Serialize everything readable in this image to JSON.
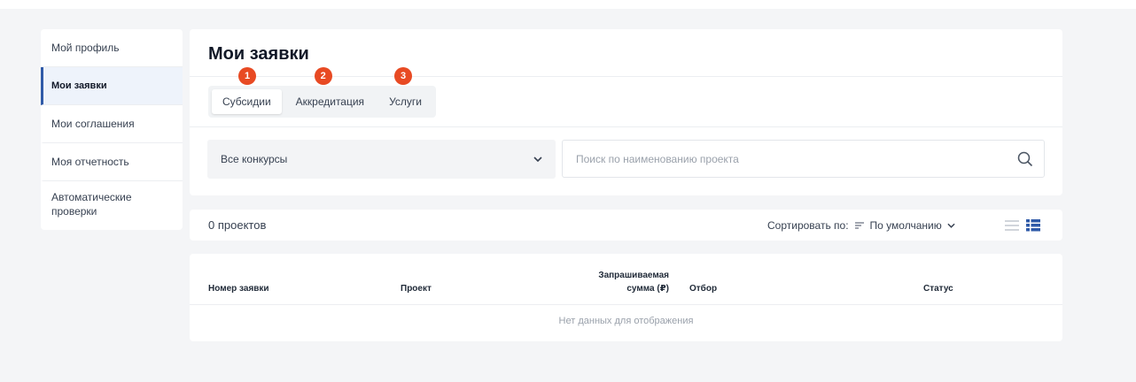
{
  "sidebar": {
    "items": [
      {
        "label": "Мой профиль",
        "active": false
      },
      {
        "label": "Мои заявки",
        "active": true
      },
      {
        "label": "Мои соглашения",
        "active": false
      },
      {
        "label": "Моя отчетность",
        "active": false
      },
      {
        "label": "Автоматические проверки",
        "active": false
      }
    ]
  },
  "main": {
    "title": "Мои заявки",
    "tabs": [
      {
        "label": "Субсидии",
        "badge": "1",
        "active": true
      },
      {
        "label": "Аккредитация",
        "badge": "2",
        "active": false
      },
      {
        "label": "Услуги",
        "badge": "3",
        "active": false
      }
    ],
    "filter": {
      "selected": "Все конкурсы"
    },
    "search": {
      "placeholder": "Поиск по наименованию проекта"
    },
    "count_label": "0 проектов",
    "sort": {
      "label": "Сортировать по:",
      "value": "По умолчанию"
    },
    "table": {
      "columns": [
        "Номер заявки",
        "Проект",
        "Запрашиваемая сумма (₽)",
        "Отбор",
        "Статус"
      ],
      "empty_text": "Нет данных для отображения"
    }
  },
  "colors": {
    "accent": "#2f5aa8",
    "badge": "#e84a23",
    "list_view_active": "#2f5aa8"
  },
  "icons": [
    "chevron-down-icon",
    "search-icon",
    "sort-icon",
    "list-view-icon",
    "grid-view-icon"
  ]
}
